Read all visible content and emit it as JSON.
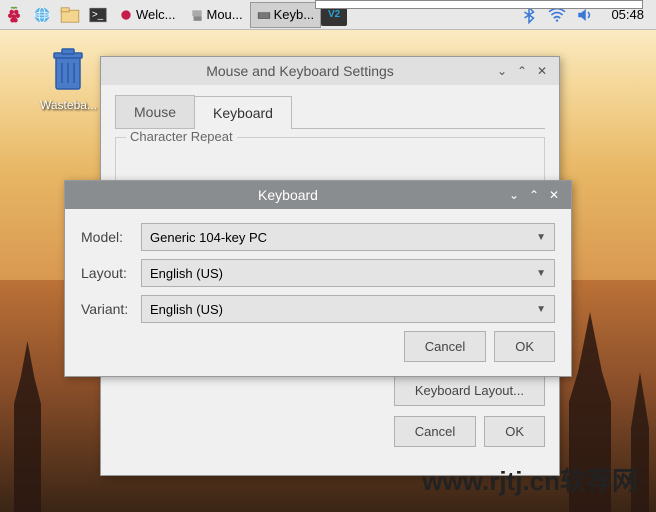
{
  "taskbar": {
    "items": [
      {
        "label": "Welc..."
      },
      {
        "label": "Mou..."
      },
      {
        "label": "Keyb..."
      }
    ],
    "time": "05:48"
  },
  "desktop": {
    "wastebasket": "Wasteba..."
  },
  "main_window": {
    "title": "Mouse and Keyboard Settings",
    "tabs": {
      "mouse": "Mouse",
      "keyboard": "Keyboard"
    },
    "fieldset_label": "Character Repeat",
    "keyboard_layout_btn": "Keyboard Layout...",
    "cancel": "Cancel",
    "ok": "OK"
  },
  "sub_window": {
    "title": "Keyboard",
    "model_label": "Model:",
    "layout_label": "Layout:",
    "variant_label": "Variant:",
    "model_value": "Generic 104-key PC",
    "layout_value": "English (US)",
    "variant_value": "English (US)",
    "cancel": "Cancel",
    "ok": "OK"
  },
  "watermark": "www.rjtj.cn软荐网"
}
